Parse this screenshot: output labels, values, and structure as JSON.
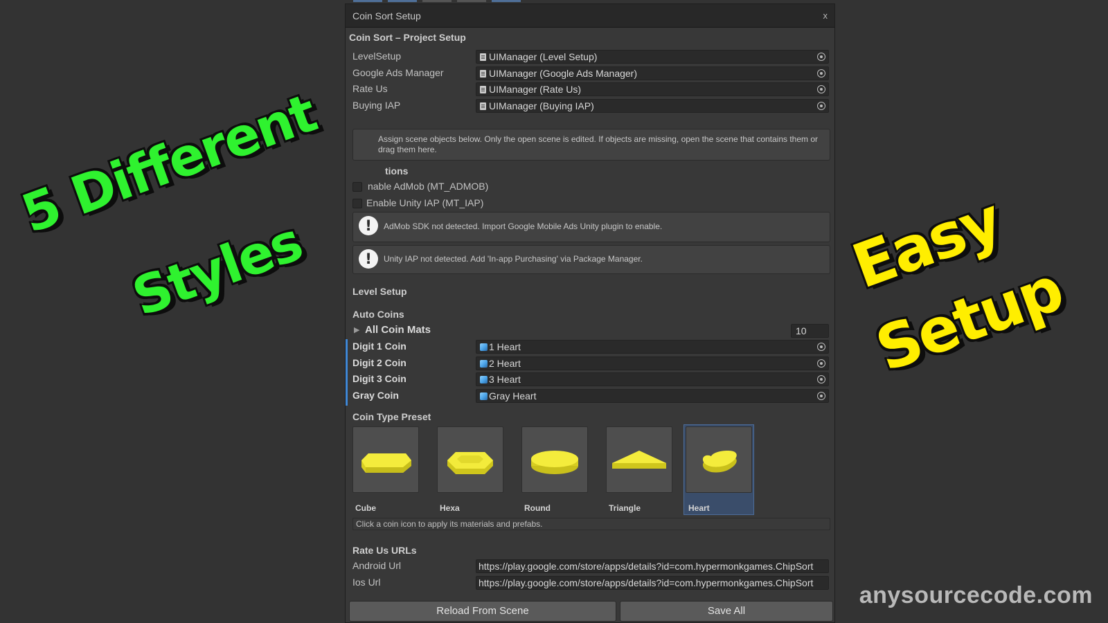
{
  "window": {
    "title": "Coin Sort Setup",
    "close_label": "x"
  },
  "project": {
    "heading": "Coin Sort – Project Setup",
    "rows": [
      {
        "label": "LevelSetup",
        "value": "UIManager (Level Setup)"
      },
      {
        "label": "Google Ads Manager",
        "value": "UIManager (Google Ads Manager)"
      },
      {
        "label": "Rate Us",
        "value": "UIManager (Rate Us)"
      },
      {
        "label": "Buying IAP",
        "value": "UIManager (Buying IAP)"
      }
    ],
    "info_text": "Assign scene objects below. Only the open scene is edited. If objects are missing, open the scene that contains them or drag them here."
  },
  "options": {
    "heading": "tions",
    "admob_label": "nable AdMob (MT_ADMOB)",
    "iap_label": "Enable Unity IAP (MT_IAP)",
    "admob_warning": "AdMob SDK not detected. Import Google Mobile Ads Unity plugin to enable.",
    "iap_warning": "Unity IAP not detected. Add 'In-app Purchasing' via Package Manager."
  },
  "level_setup": {
    "heading": "Level Setup",
    "auto_coins_label": "Auto Coins",
    "all_coin_mats_label": "All Coin Mats",
    "all_coin_mats_count": "10",
    "coins": [
      {
        "label": "Digit 1 Coin",
        "value": "1 Heart"
      },
      {
        "label": "Digit 2 Coin",
        "value": "2 Heart"
      },
      {
        "label": "Digit 3 Coin",
        "value": "3 Heart"
      },
      {
        "label": "Gray Coin",
        "value": "Gray Heart"
      }
    ]
  },
  "coin_type": {
    "heading": "Coin Type Preset",
    "presets": [
      {
        "name": "Cube",
        "icon": "cube-coin-icon"
      },
      {
        "name": "Hexa",
        "icon": "hexa-coin-icon"
      },
      {
        "name": "Round",
        "icon": "round-coin-icon"
      },
      {
        "name": "Triangle",
        "icon": "triangle-coin-icon"
      },
      {
        "name": "Heart",
        "icon": "heart-coin-icon"
      }
    ],
    "selected": "Heart",
    "hint": "Click a coin icon to apply its materials and prefabs."
  },
  "rate_us": {
    "heading": "Rate Us URLs",
    "android_label": "Android Url",
    "android_value": "https://play.google.com/store/apps/details?id=com.hypermonkgames.ChipSort",
    "ios_label": "Ios Url",
    "ios_value": "https://play.google.com/store/apps/details?id=com.hypermonkgames.ChipSort"
  },
  "buttons": {
    "reload_label": "Reload From Scene",
    "save_label": "Save All"
  },
  "overlay": {
    "green_line1": "5 Different",
    "green_line2": "Styles",
    "yellow_line1": "Easy",
    "yellow_line2": "Setup",
    "watermark": "anysourcecode.com"
  },
  "colors": {
    "accent_blue": "#3f87d6",
    "overlay_green": "#2ff22f",
    "overlay_yellow": "#ffee00",
    "coin_yellow": "#f2ea3a"
  }
}
